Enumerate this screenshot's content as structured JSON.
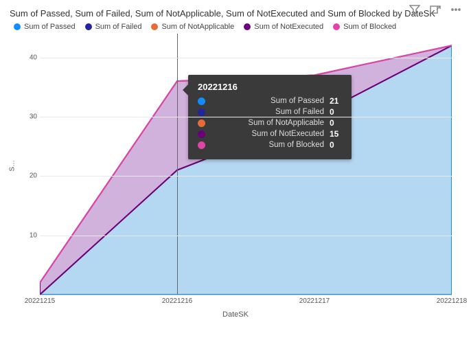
{
  "title": "Sum of Passed, Sum of Failed, Sum of NotApplicable, Sum of NotExecuted and Sum of Blocked by DateSK",
  "legend_items": [
    {
      "label": "Sum of Passed",
      "color": "#118dff"
    },
    {
      "label": "Sum of Failed",
      "color": "#24249e"
    },
    {
      "label": "Sum of NotApplicable",
      "color": "#e66c37"
    },
    {
      "label": "Sum of NotExecuted",
      "color": "#6b007b"
    },
    {
      "label": "Sum of Blocked",
      "color": "#e044a7"
    }
  ],
  "chart_data": {
    "type": "area",
    "stacked": true,
    "xlabel": "DateSK",
    "ylabel": "Sum of Passed, Sum of Failed, Sum of NotApplicable, Sum of NotExec...",
    "categories": [
      "20221215",
      "20221216",
      "20221217",
      "20221218"
    ],
    "series": [
      {
        "name": "Sum of Passed",
        "color": "#118dff",
        "area": "#a8d1f0",
        "values": [
          0,
          21,
          30,
          42
        ]
      },
      {
        "name": "Sum of Failed",
        "color": "#24249e",
        "area": "#24249e",
        "values": [
          0,
          0,
          0,
          0
        ]
      },
      {
        "name": "Sum of NotApplicable",
        "color": "#e66c37",
        "area": "#e66c37",
        "values": [
          0,
          0,
          0,
          0
        ]
      },
      {
        "name": "Sum of NotExecuted",
        "color": "#6b007b",
        "area": "#c9a4d7",
        "values": [
          2,
          15,
          7,
          0
        ]
      },
      {
        "name": "Sum of Blocked",
        "color": "#e044a7",
        "area": "#e044a7",
        "values": [
          0,
          0,
          0,
          0
        ]
      }
    ],
    "ylim": [
      0,
      44
    ],
    "yticks": [
      10,
      20,
      30,
      40
    ]
  },
  "tooltip": {
    "date": "20221216",
    "index": 1,
    "rows": [
      {
        "color": "#118dff",
        "label": "Sum of Passed",
        "value": "21"
      },
      {
        "color": "#24249e",
        "label": "Sum of Failed",
        "value": "0"
      },
      {
        "color": "#e66c37",
        "label": "Sum of NotApplicable",
        "value": "0"
      },
      {
        "color": "#6b007b",
        "label": "Sum of NotExecuted",
        "value": "15"
      },
      {
        "color": "#e044a7",
        "label": "Sum of Blocked",
        "value": "0"
      }
    ]
  }
}
